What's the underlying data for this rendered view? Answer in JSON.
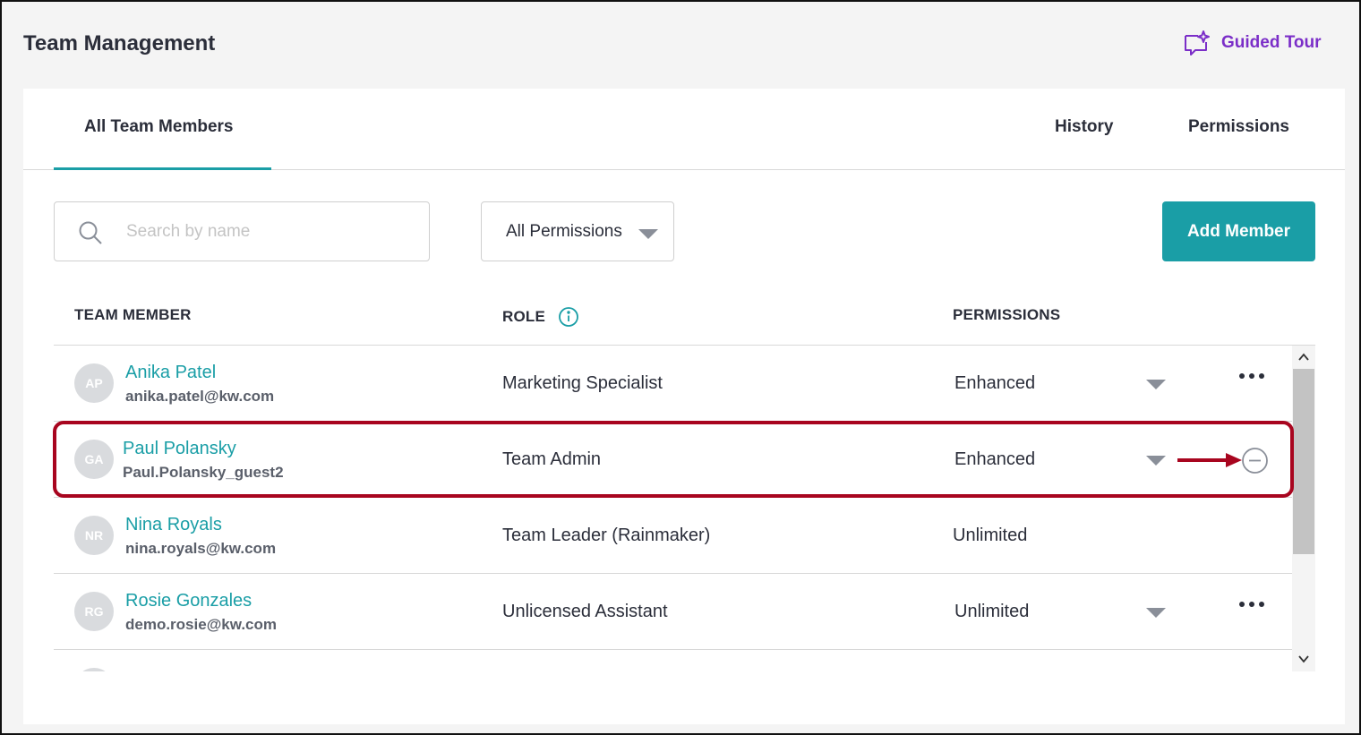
{
  "header": {
    "title": "Team Management",
    "guided_tour_label": "Guided Tour",
    "guided_tour_icon": "sparkle-chat-icon"
  },
  "tabs": [
    {
      "label": "All Team Members",
      "active": true
    },
    {
      "label": "History",
      "active": false
    },
    {
      "label": "Permissions",
      "active": false
    }
  ],
  "toolbar": {
    "search_placeholder": "Search by name",
    "search_value": "",
    "permission_filter_value": "All Permissions",
    "add_member_label": "Add Member"
  },
  "table": {
    "columns": [
      "TEAM MEMBER",
      "ROLE",
      "PERMISSIONS"
    ],
    "rows": [
      {
        "initials": "AP",
        "name": "Anika Patel",
        "email": "anika.patel@kw.com",
        "role": "Marketing Specialist",
        "permissions": "Enhanced",
        "action": "more"
      },
      {
        "initials": "GA",
        "name": "Paul Polansky",
        "email": "Paul.Polansky_guest2",
        "role": "Team Admin",
        "permissions": "Enhanced",
        "action": "remove"
      },
      {
        "initials": "NR",
        "name": "Nina Royals",
        "email": "nina.royals@kw.com",
        "role": "Team Leader (Rainmaker)",
        "permissions": "Unlimited",
        "action": "none"
      },
      {
        "initials": "RG",
        "name": "Rosie Gonzales",
        "email": "demo.rosie@kw.com",
        "role": "Unlicensed Assistant",
        "permissions": "Unlimited",
        "action": "more"
      }
    ]
  },
  "colors": {
    "accent": "#1a9ea6",
    "guided_tour": "#7b2ec8",
    "highlight": "#a8051f"
  }
}
